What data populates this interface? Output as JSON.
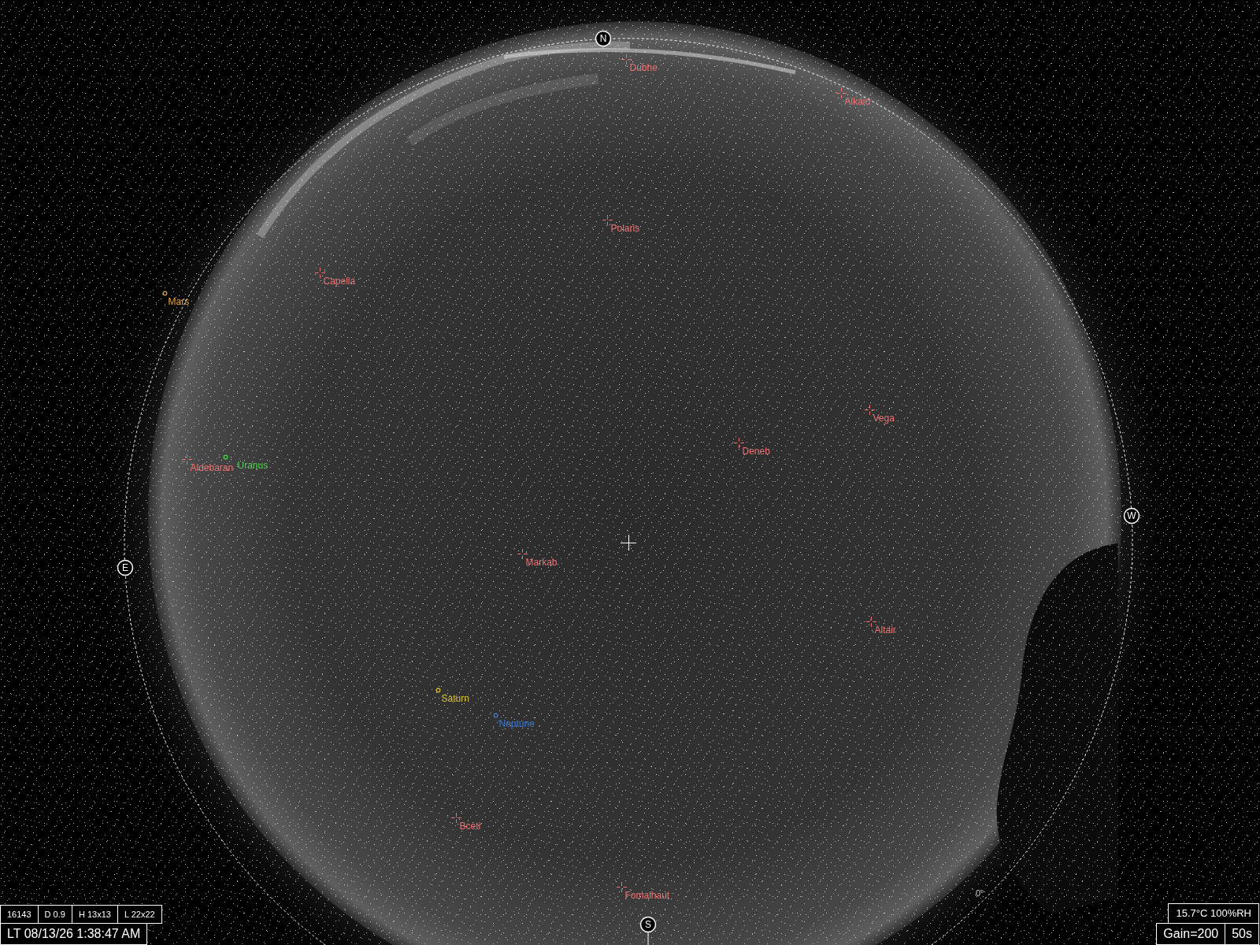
{
  "compass": [
    "N",
    "E",
    "S",
    "W"
  ],
  "objects": [
    {
      "kind": "star",
      "name": "Dubhe",
      "color": "#ee7272"
    },
    {
      "kind": "star",
      "name": "Alkaid",
      "color": "#ee7272"
    },
    {
      "kind": "star",
      "name": "Polaris",
      "color": "#ee7272"
    },
    {
      "kind": "star",
      "name": "Capella",
      "color": "#ee7272"
    },
    {
      "kind": "planet",
      "name": "Mars",
      "color": "#e8a03c"
    },
    {
      "kind": "star",
      "name": "Vega",
      "color": "#ee7272"
    },
    {
      "kind": "star",
      "name": "Deneb",
      "color": "#ee7272"
    },
    {
      "kind": "star",
      "name": "Aldebaran",
      "color": "#ee7272"
    },
    {
      "kind": "planet",
      "name": "Uranus",
      "color": "#4cd24c"
    },
    {
      "kind": "star",
      "name": "Markab",
      "color": "#ee7272"
    },
    {
      "kind": "star",
      "name": "Altair",
      "color": "#ee7272"
    },
    {
      "kind": "planet",
      "name": "Saturn",
      "color": "#d8c23a"
    },
    {
      "kind": "planet",
      "name": "Neptune",
      "color": "#3c78d8"
    },
    {
      "kind": "star",
      "name": "Bceti",
      "color": "#ee7272"
    },
    {
      "kind": "star",
      "name": "Fomalhaut",
      "color": "#ee7272"
    }
  ],
  "horizon_mark": "0°",
  "status_left": {
    "readouts": [
      "16143",
      "D 0.9",
      "H 13x13",
      "L 22x22"
    ],
    "timestamp": "LT 08/13/26 1:38:47 AM"
  },
  "status_right": {
    "conditions": "15.7°C 100%RH",
    "gain": "Gain=200",
    "exposure": "50s"
  }
}
